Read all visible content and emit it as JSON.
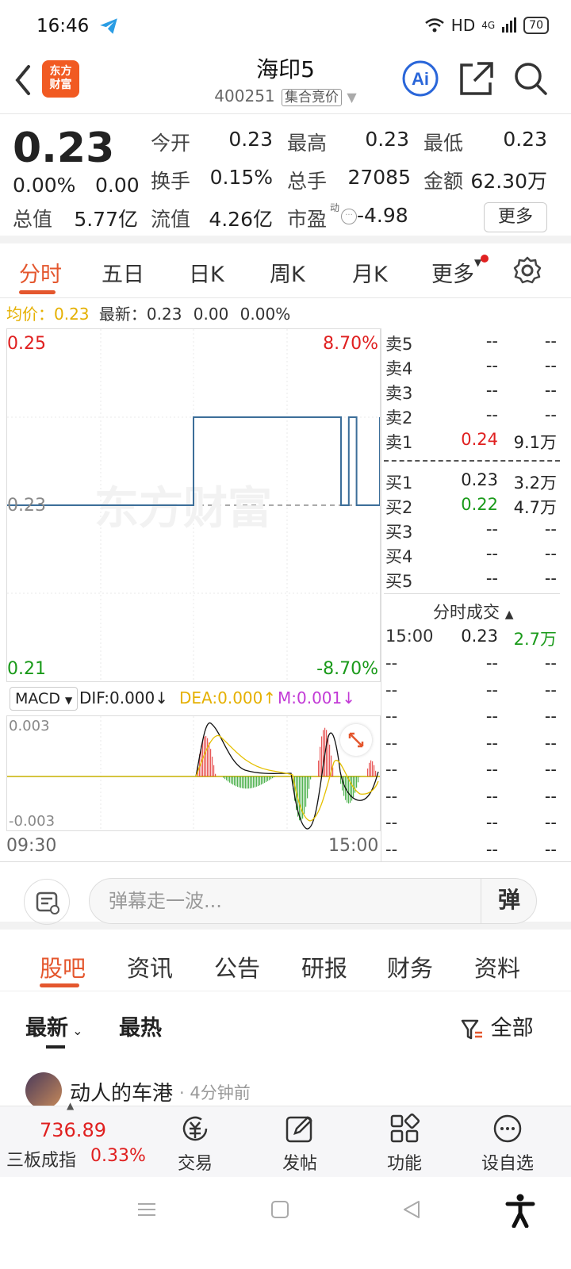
{
  "status_bar": {
    "time": "16:46",
    "network": "HD",
    "signal": "4G",
    "battery": "70"
  },
  "header": {
    "title": "海印5",
    "code": "400251",
    "tag": "集合竞价",
    "logo_line1": "东方",
    "logo_line2": "财富",
    "ai_label": "Ai"
  },
  "quote": {
    "price": "0.23",
    "change_pct": "0.00%",
    "change": "0.00",
    "open_label": "今开",
    "open": "0.23",
    "high_label": "最高",
    "high": "0.23",
    "low_label": "最低",
    "low": "0.23",
    "turnover_label": "换手",
    "turnover": "0.15%",
    "volume_label": "总手",
    "volume": "27085",
    "amount_label": "金额",
    "amount": "62.30万",
    "mcap_label": "总值",
    "mcap": "5.77亿",
    "float_label": "流值",
    "float": "4.26亿",
    "pe_label": "市盈",
    "pe_sup": "动",
    "pe": "-4.98",
    "more_label": "更多"
  },
  "tabs": [
    "分时",
    "五日",
    "日K",
    "周K",
    "月K",
    "更多"
  ],
  "avg_line": {
    "avg_label": "均价：",
    "avg": "0.23",
    "latest_label": "最新：",
    "latest": "0.23",
    "chg": "0.00",
    "pct": "0.00%"
  },
  "chart": {
    "y_top": "0.25",
    "y_mid": "0.23",
    "y_bottom": "0.21",
    "pct_top": "8.70%",
    "pct_bottom": "-8.70%",
    "x_start": "09:30",
    "x_end": "15:00",
    "watermark": "东方财富",
    "colors": {
      "price_line": "#3c6e99",
      "up": "#e02020",
      "down": "#1a9a1a"
    }
  },
  "chart_data": {
    "type": "line",
    "title": "",
    "xlabel": "",
    "ylabel": "",
    "ylim": [
      0.21,
      0.25
    ],
    "x": [
      "09:30",
      "12:00",
      "13:00",
      "14:30",
      "14:35",
      "14:40",
      "14:45",
      "14:58",
      "15:00"
    ],
    "series": [
      {
        "values": [
          0.23,
          0.23,
          0.24,
          0.24,
          0.23,
          0.24,
          0.23,
          0.23,
          0.24
        ]
      }
    ]
  },
  "order_book": {
    "asks": [
      {
        "label": "卖5",
        "price": "--",
        "vol": "--"
      },
      {
        "label": "卖4",
        "price": "--",
        "vol": "--"
      },
      {
        "label": "卖3",
        "price": "--",
        "vol": "--"
      },
      {
        "label": "卖2",
        "price": "--",
        "vol": "--"
      },
      {
        "label": "卖1",
        "price": "0.24",
        "vol": "9.1万"
      }
    ],
    "bids": [
      {
        "label": "买1",
        "price": "0.23",
        "vol": "3.2万"
      },
      {
        "label": "买2",
        "price": "0.22",
        "vol": "4.7万"
      },
      {
        "label": "买3",
        "price": "--",
        "vol": "--"
      },
      {
        "label": "买4",
        "price": "--",
        "vol": "--"
      },
      {
        "label": "买5",
        "price": "--",
        "vol": "--"
      }
    ],
    "trades_title": "分时成交",
    "trade": {
      "time": "15:00",
      "price": "0.23",
      "vol": "2.7万"
    },
    "placeholder": "--"
  },
  "macd": {
    "selector": "MACD",
    "dif": "DIF:0.000↓",
    "dea": "DEA:0.000↑",
    "m": "M:0.001↓",
    "y_top": "0.003",
    "y_bottom": "-0.003"
  },
  "danmu": {
    "placeholder": "弹幕走一波...",
    "button": "弹"
  },
  "news_tabs": [
    "股吧",
    "资讯",
    "公告",
    "研报",
    "财务",
    "资料"
  ],
  "sort": {
    "latest": "最新",
    "hot": "最热",
    "filter": "全部"
  },
  "post": {
    "author": "动人的车港",
    "time": "· 4分钟前"
  },
  "bottom_bar": {
    "index_value": "736.89",
    "index_name": "三板成指",
    "index_pct": "0.33%",
    "items": [
      "交易",
      "发帖",
      "功能",
      "设自选"
    ]
  }
}
